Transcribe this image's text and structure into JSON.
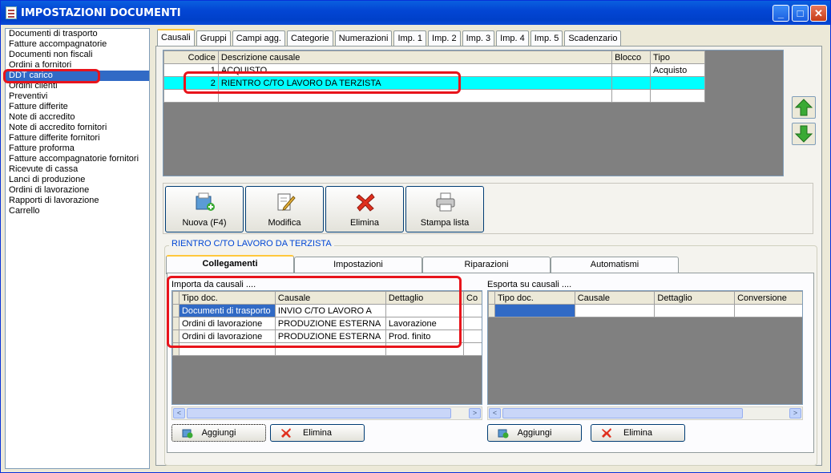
{
  "window": {
    "title": "IMPOSTAZIONI DOCUMENTI",
    "min": "_",
    "max": "□",
    "close": "✕"
  },
  "sidebar": {
    "items": [
      "Documenti di trasporto",
      "Fatture accompagnatorie",
      "Documenti non fiscali",
      "Ordini a fornitori",
      "DDT carico",
      "Ordini clienti",
      "Preventivi",
      "Fatture differite",
      "Note di accredito",
      "Note di accredito fornitori",
      "Fatture differite fornitori",
      "Fatture proforma",
      "Fatture accompagnatorie fornitori",
      "Ricevute di cassa",
      "Lanci di produzione",
      "Ordini di lavorazione",
      "Rapporti di lavorazione",
      "Carrello"
    ],
    "selected_index": 4
  },
  "tabs": [
    "Causali",
    "Gruppi",
    "Campi agg.",
    "Categorie",
    "Numerazioni",
    "Imp. 1",
    "Imp. 2",
    "Imp. 3",
    "Imp. 4",
    "Imp. 5",
    "Scadenzario"
  ],
  "causali": {
    "headers": [
      "Codice",
      "Descrizione causale",
      "Blocco",
      "Tipo"
    ],
    "rows": [
      [
        "1",
        "ACQUISTO",
        "",
        "Acquisto"
      ],
      [
        "2",
        "RIENTRO C/TO LAVORO DA TERZISTA",
        "",
        ""
      ],
      [
        "",
        "",
        "",
        ""
      ]
    ]
  },
  "actions": {
    "new": "Nuova (F4)",
    "edit": "Modifica",
    "delete": "Elimina",
    "print": "Stampa lista"
  },
  "group_title": "RIENTRO C/TO LAVORO DA TERZISTA",
  "subtabs": [
    "Collegamenti",
    "Impostazioni",
    "Riparazioni",
    "Automatismi"
  ],
  "importa": {
    "label": "Importa da causali ....",
    "headers": [
      "Tipo doc.",
      "Causale",
      "Dettaglio",
      "Co"
    ],
    "rows": [
      [
        "Documenti di trasporto",
        "INVIO C/TO LAVORO A",
        "",
        ""
      ],
      [
        "Ordini di lavorazione",
        "PRODUZIONE ESTERNA",
        "Lavorazione",
        ""
      ],
      [
        "Ordini di lavorazione",
        "PRODUZIONE ESTERNA",
        "Prod. finito",
        ""
      ],
      [
        "",
        "",
        "",
        ""
      ]
    ],
    "add": "Aggiungi",
    "delete": "Elimina"
  },
  "esporta": {
    "label": "Esporta su causali ....",
    "headers": [
      "Tipo doc.",
      "Causale",
      "Dettaglio",
      "Conversione"
    ],
    "rows": [
      [
        "",
        "",
        "",
        ""
      ]
    ],
    "add": "Aggiungi",
    "delete": "Elimina"
  },
  "scroll": {
    "left": "<",
    "right": ">"
  },
  "colors": {
    "title_bar": "#0346d4",
    "selection": "#316ac5",
    "highlight_row": "#00ffff",
    "annotation": "#e8141b"
  }
}
